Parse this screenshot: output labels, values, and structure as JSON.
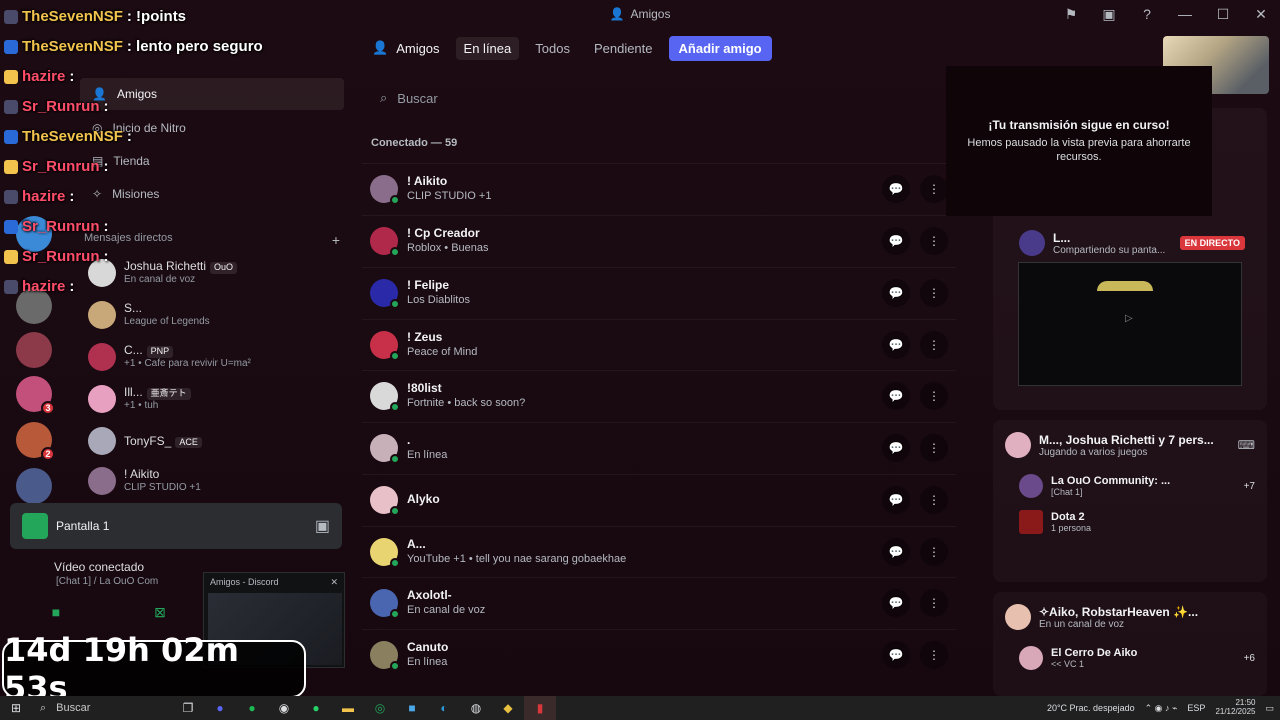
{
  "window": {
    "title": "Amigos"
  },
  "sidebar": {
    "nav": [
      "Amigos",
      "Inicio de Nitro",
      "Tienda",
      "Misiones"
    ],
    "dm_header": "Mensajes directos",
    "dms": [
      {
        "name": "Joshua Richetti",
        "tag": "OuO",
        "status": "En canal de voz"
      },
      {
        "name": "S...",
        "tag": "",
        "status": "League of Legends"
      },
      {
        "name": "C...",
        "tag": "PNP",
        "status": "+1 • Cafe para revivir U=ma²"
      },
      {
        "name": "Ill...",
        "tag": "亜斎テト",
        "status": "+1 • tuh"
      },
      {
        "name": "TonyFS_",
        "tag": "ACE",
        "status": ""
      },
      {
        "name": "! Aikito",
        "tag": "",
        "status": "CLIP STUDIO +1"
      }
    ],
    "badges": [
      "3",
      "2"
    ]
  },
  "stream": {
    "label": "Pantalla 1"
  },
  "voice": {
    "status": "Vídeo conectado",
    "channel": "[Chat 1] / La OuO Com"
  },
  "popup": {
    "title": "Amigos - Discord"
  },
  "tabs": {
    "friends": "Amigos",
    "online": "En línea",
    "all": "Todos",
    "pending": "Pendiente",
    "add": "Añadir amigo"
  },
  "search": {
    "placeholder": "Buscar"
  },
  "section": "Conectado — 59",
  "friends": [
    {
      "name": "! Aikito",
      "status": "CLIP STUDIO +1",
      "color": "#8a6d8a"
    },
    {
      "name": "! Cp Creador",
      "status": "Roblox • Buenas",
      "color": "#b0294a"
    },
    {
      "name": "! Felipe",
      "status": "Los Diablitos",
      "color": "#2a2aa8"
    },
    {
      "name": "! Zeus",
      "status": "Peace of Mind",
      "color": "#c8304a"
    },
    {
      "name": "!80list",
      "status": "Fortnite • back so soon?",
      "color": "#d9d9d9"
    },
    {
      "name": ".",
      "status": "En línea",
      "color": "#c8b0b8"
    },
    {
      "name": "Alyko",
      "status": "",
      "color": "#e8c0c8"
    },
    {
      "name": "A...",
      "status": "YouTube +1 • tell you nae sarang gobaekhae",
      "color": "#e8d470"
    },
    {
      "name": "Axolotl-",
      "status": "En canal de voz",
      "color": "#4a66b0"
    },
    {
      "name": "Canuto",
      "status": "En línea",
      "color": "#8a8060"
    }
  ],
  "notice": {
    "heading": "¡Tu transmisión sigue en curso!",
    "body": "Hemos pausado la vista previa para ahorrarte recursos."
  },
  "activity": {
    "live": {
      "name": "L...",
      "status": "Compartiendo su panta...",
      "badge": "EN DIRECTO"
    },
    "games": {
      "name": "M..., Joshua Richetti y 7 pers...",
      "status": "Jugando a varios juegos",
      "items": [
        {
          "name": "La OuO Community: ...",
          "status": "[Chat 1]",
          "extra": "+7"
        },
        {
          "name": "Dota 2",
          "status": "1 persona",
          "extra": ""
        }
      ]
    },
    "voice": {
      "name": "✧Aiko, RobstarHeaven ✨...",
      "status": "En un canal de voz",
      "items": [
        {
          "name": "El Cerro De Aiko",
          "status": "<< VC 1",
          "extra": "+6"
        }
      ]
    }
  },
  "overlay": [
    {
      "user": "TheSevenNSF",
      "msg": ": !points",
      "cls": "u"
    },
    {
      "user": "TheSevenNSF",
      "msg": ": lento pero seguro",
      "cls": "u"
    },
    {
      "user": "hazire",
      "msg": ":",
      "cls": "r"
    },
    {
      "user": "Sr_Runrun",
      "msg": ":",
      "cls": "r"
    },
    {
      "user": "TheSevenNSF",
      "msg": ":",
      "cls": "u"
    },
    {
      "user": "Sr_Runrun",
      "msg": ":",
      "cls": "r"
    },
    {
      "user": "hazire",
      "msg": ":",
      "cls": "r"
    },
    {
      "user": "Sr_Runrun",
      "msg": ":",
      "cls": "r"
    },
    {
      "user": "Sr_Runrun",
      "msg": ":",
      "cls": "r"
    },
    {
      "user": "hazire",
      "msg": ":",
      "cls": "r"
    }
  ],
  "countdown": "14d 19h 02m 53s",
  "taskbar": {
    "search": "Buscar",
    "weather": "20°C  Prac. despejado",
    "lang": "ESP",
    "time": "21:50",
    "date": "21/12/2025"
  },
  "colors": {
    "accent": "#5865f2",
    "online": "#23a55a",
    "live": "#da373c"
  }
}
